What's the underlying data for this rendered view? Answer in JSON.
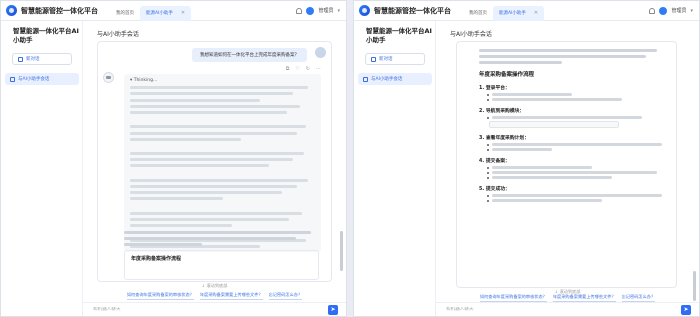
{
  "app": {
    "brand": "智慧能源管控一体化平台",
    "user_name": "管理员",
    "tabs": [
      {
        "label": "我的首页"
      },
      {
        "label": "能源AI小助手"
      }
    ]
  },
  "sidebar": {
    "title": "智慧能源一体化平台AI小助手",
    "new_chat_label": "新对话",
    "items": [
      {
        "label": "与AI小助手会话"
      }
    ]
  },
  "main": {
    "title": "与AI小助手会话",
    "user_message": "我想知道如何在一体化平台上完成年度采购备案？",
    "thinking_label": "▾ Thinking...",
    "answer_title": "年度采购备案操作流程",
    "scroll_hint": "↓ 滚动到底部",
    "suggestions": [
      "如何查询年度采购备案的审核状态？",
      "年度采购备案需要上传哪些文件？",
      "忘记密码怎么办？"
    ],
    "input_placeholder": "和机器人聊天"
  },
  "doc": {
    "title": "年度采购备案操作流程",
    "steps": [
      {
        "num": "1.",
        "title": "登录平台："
      },
      {
        "num": "2.",
        "title": "导航到采购模块："
      },
      {
        "num": "3.",
        "title": "查看年度采购计划："
      },
      {
        "num": "4.",
        "title": "提交备案："
      },
      {
        "num": "5.",
        "title": "提交成功："
      }
    ]
  },
  "colors": {
    "accent": "#2f6df6",
    "selected_bg": "#e8efff"
  }
}
